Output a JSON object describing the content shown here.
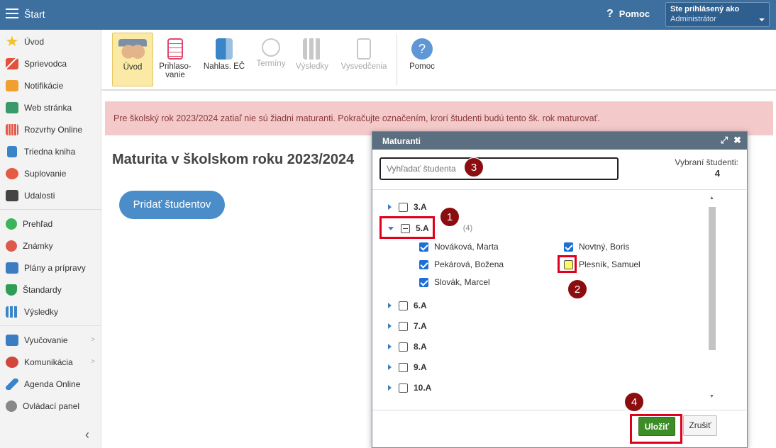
{
  "topbar": {
    "title": "Štart",
    "help_label": "Pomoc",
    "user_label": "Ste prihlásený ako",
    "user_role": "Administrátor"
  },
  "sidebar": {
    "items": [
      {
        "label": "Úvod",
        "icon": "star-icon"
      },
      {
        "label": "Sprievodca",
        "icon": "wand-icon"
      },
      {
        "label": "Notifikácie",
        "icon": "envelope-icon"
      },
      {
        "label": "Web stránka",
        "icon": "home-icon"
      },
      {
        "label": "Rozvrhy Online",
        "icon": "calendar-grid-icon"
      },
      {
        "label": "Triedna kniha",
        "icon": "book-icon"
      },
      {
        "label": "Suplovanie",
        "icon": "person-icon"
      },
      {
        "label": "Udalosti",
        "icon": "calendar-icon"
      },
      {
        "label": "Prehľad",
        "icon": "check-circle-icon"
      },
      {
        "label": "Známky",
        "icon": "grade-icon"
      },
      {
        "label": "Plány a prípravy",
        "icon": "briefcase-icon"
      },
      {
        "label": "Štandardy",
        "icon": "shield-icon"
      },
      {
        "label": "Výsledky",
        "icon": "bar-chart-icon"
      },
      {
        "label": "Vyučovanie",
        "icon": "open-book-icon"
      },
      {
        "label": "Komunikácia",
        "icon": "chat-icon"
      },
      {
        "label": "Agenda Online",
        "icon": "pen-icon"
      },
      {
        "label": "Ovládací panel",
        "icon": "gear-icon"
      }
    ]
  },
  "toolbar": {
    "items": [
      {
        "label": "Úvod",
        "icon": "students-icon"
      },
      {
        "label": "Prihlaso-\nvanie",
        "icon": "list-doc-icon"
      },
      {
        "label": "Nahlas. EČ",
        "icon": "arrow-doc-icon"
      },
      {
        "label": "Termíny",
        "icon": "clock-icon"
      },
      {
        "label": "Výsledky",
        "icon": "bars-icon"
      },
      {
        "label": "Vysvedčenia",
        "icon": "certificate-icon"
      },
      {
        "label": "Pomoc",
        "icon": "help-circle-icon"
      }
    ]
  },
  "alert": {
    "text": "Pre školský rok 2023/2024 zatiaľ nie sú žiadni maturanti. Pokračujte označením, krorí študenti budú tento šk. rok maturovať."
  },
  "main": {
    "title": "Maturita v školskom roku 2023/2024",
    "add_button": "Pridať študentov"
  },
  "dialog": {
    "title": "Maturanti",
    "search_placeholder": "Vyhľadať študenta",
    "selected_label": "Vybraní študenti:",
    "selected_count": "4",
    "classes": [
      {
        "name": "3.A"
      },
      {
        "name": "5.A",
        "count": "(4)"
      },
      {
        "name": "6.A"
      },
      {
        "name": "7.A"
      },
      {
        "name": "8.A"
      },
      {
        "name": "9.A"
      },
      {
        "name": "10.A"
      }
    ],
    "students": [
      {
        "name": "Nováková, Marta",
        "checked": true
      },
      {
        "name": "Novtný, Boris",
        "checked": true
      },
      {
        "name": "Pekárová, Božena",
        "checked": true
      },
      {
        "name": "Plesník, Samuel",
        "checked": false
      },
      {
        "name": "Slovák, Marcel",
        "checked": true
      }
    ],
    "save_label": "Uložiť",
    "cancel_label": "Zrušiť"
  },
  "markers": [
    "1",
    "2",
    "3",
    "4"
  ],
  "colors": {
    "topbar": "#3d6f9f",
    "alert_bg": "#f3c9ca",
    "highlight": "#e0001b",
    "marker": "#8b0d10",
    "save": "#3c8c27"
  }
}
